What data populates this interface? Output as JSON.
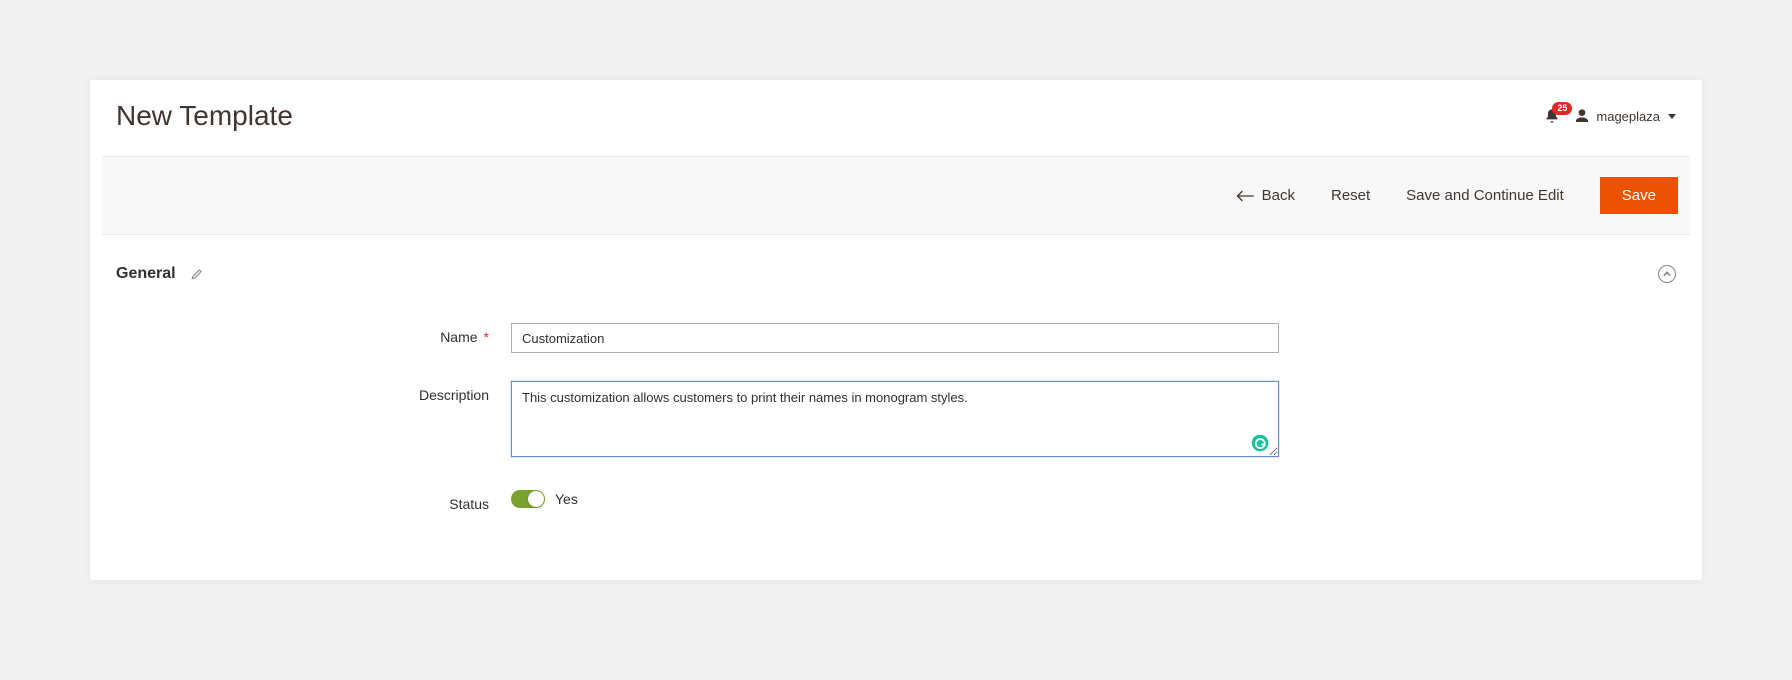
{
  "header": {
    "page_title": "New Template",
    "notification_count": "25",
    "account_name": "mageplaza"
  },
  "actions": {
    "back_label": "Back",
    "reset_label": "Reset",
    "save_continue_label": "Save and Continue Edit",
    "save_label": "Save"
  },
  "section": {
    "title": "General"
  },
  "form": {
    "name_label": "Name",
    "name_value": "Customization",
    "description_label": "Description",
    "description_value": "This customization allows customers to print their names in monogram styles.",
    "status_label": "Status",
    "status_value": "Yes"
  }
}
